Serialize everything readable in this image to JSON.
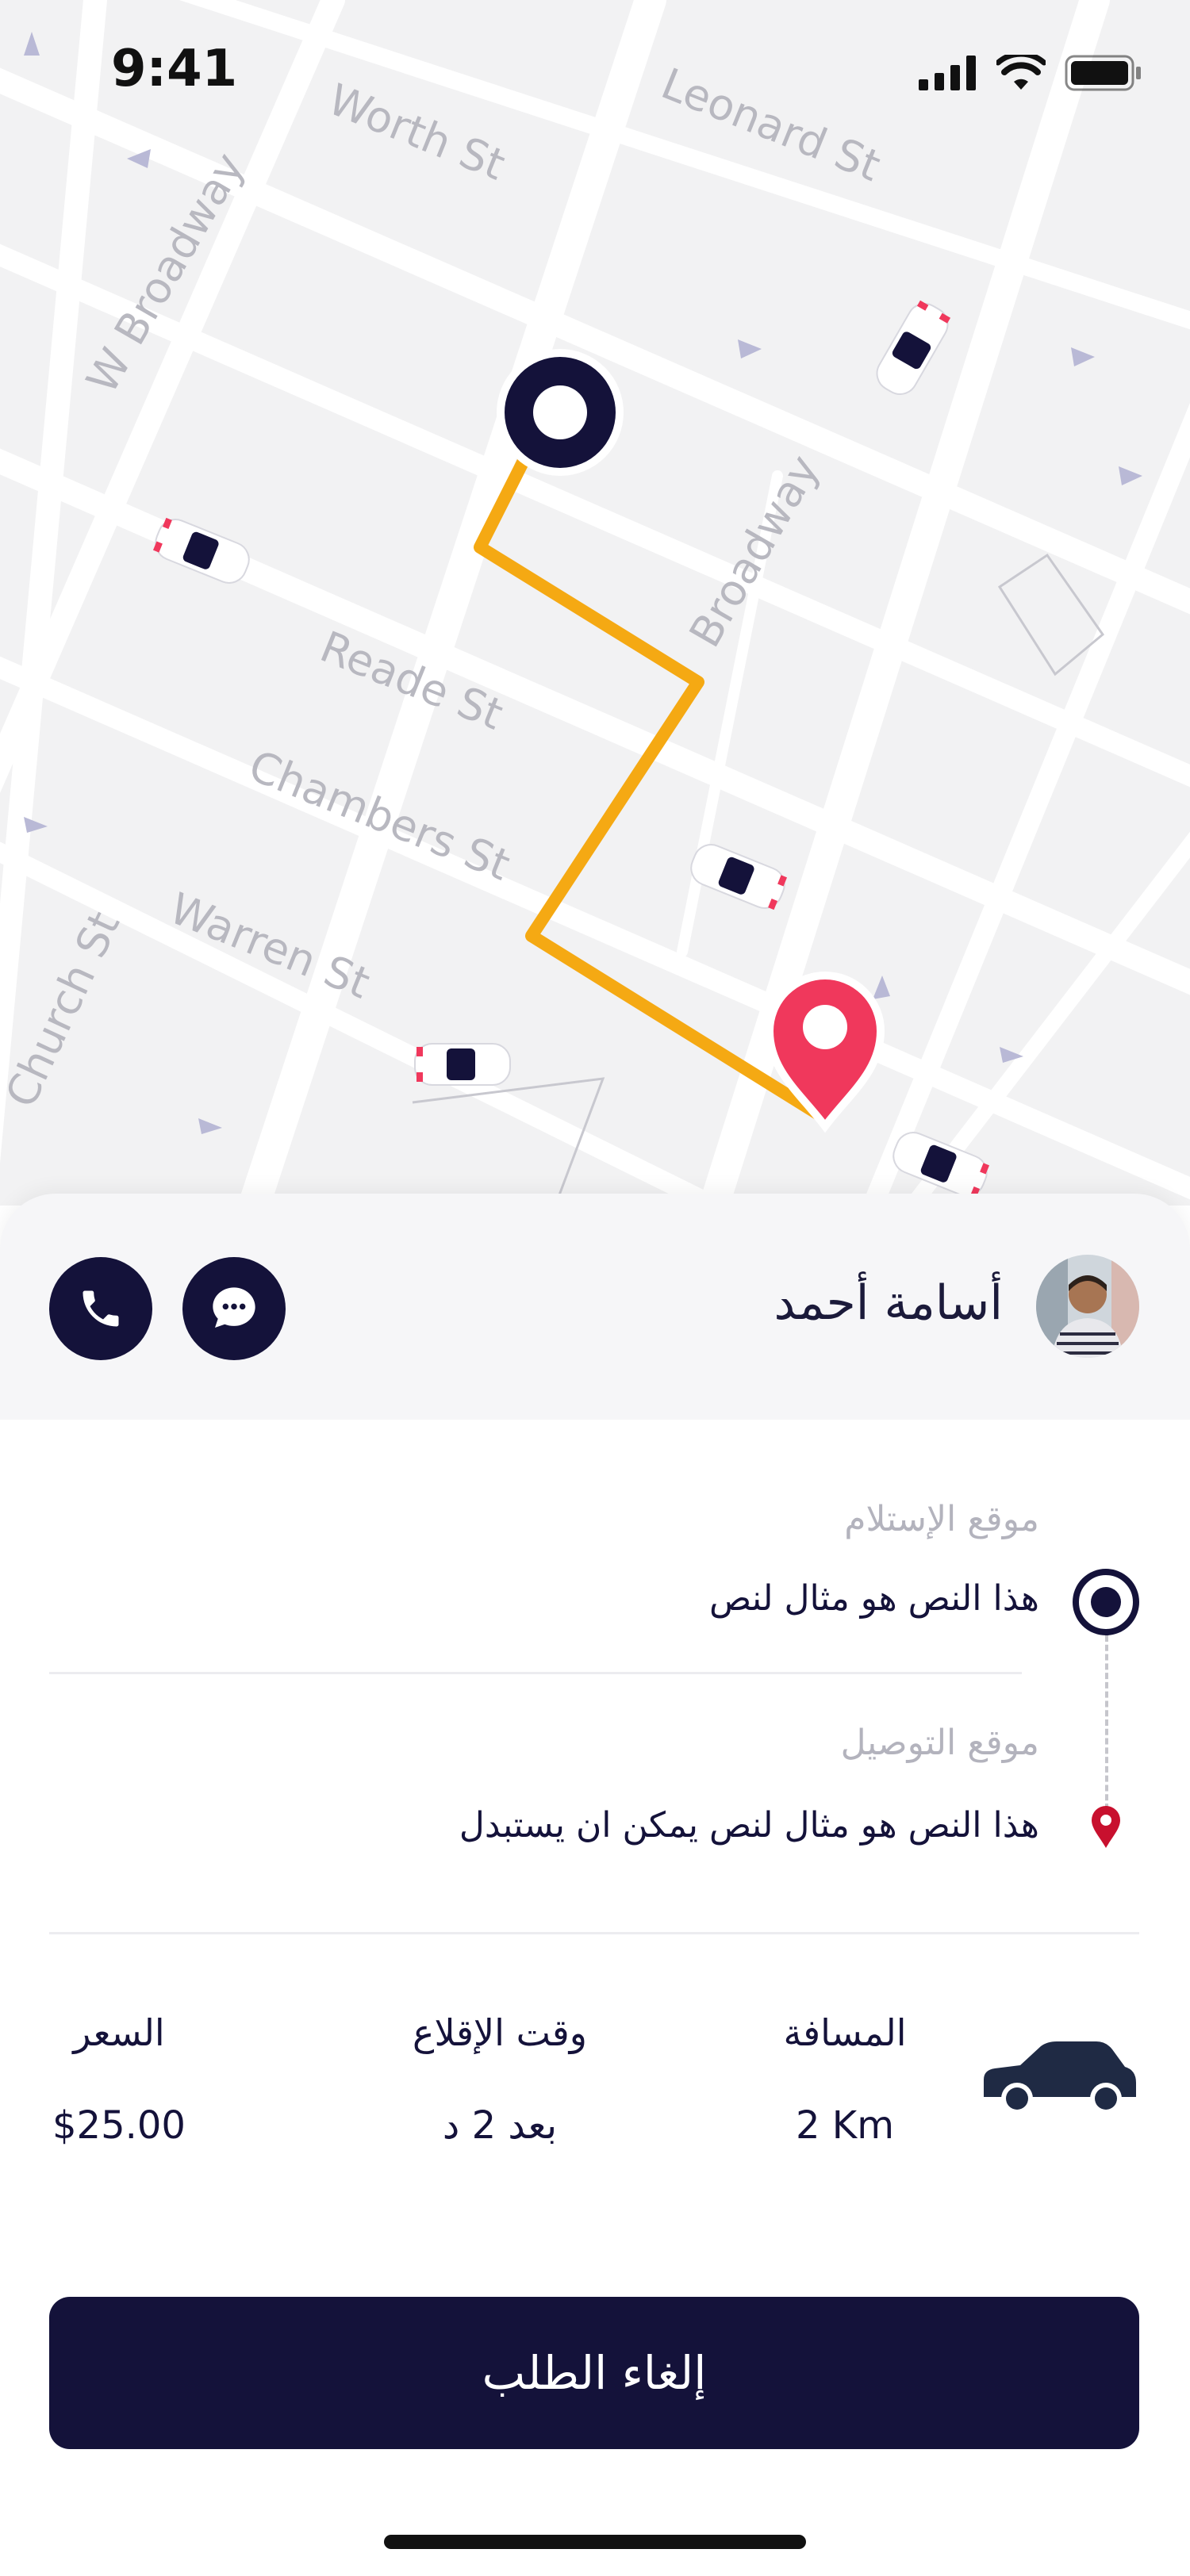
{
  "status_bar": {
    "time": "9:41"
  },
  "map": {
    "street_labels": {
      "worth": "Worth St",
      "leonard": "Leonard St",
      "w_broadway": "W Broadway",
      "broadway": "Broadway",
      "reade": "Reade St",
      "chambers": "Chambers St",
      "warren": "Warren St",
      "church": "Church St"
    },
    "route_color": "#F5A913",
    "origin_color": "#14123A",
    "destination_color": "#F0385C"
  },
  "driver": {
    "name": "أسامة أحمد",
    "call_icon": "phone-icon",
    "message_icon": "chat-icon"
  },
  "trip": {
    "pickup_label": "موقع الإستلام",
    "pickup_address": "هذا النص هو مثال لنص",
    "dropoff_label": "موقع التوصيل",
    "dropoff_address": "هذا النص هو مثال لنص يمكن ان يستبدل"
  },
  "stats": {
    "distance_label": "المسافة",
    "distance_value": "2 Km",
    "eta_label": "وقت الإقلاع",
    "eta_value": "بعد 2 د",
    "price_label": "السعر",
    "price_value": "$25.00"
  },
  "actions": {
    "cancel_label": "إلغاء الطلب"
  },
  "colors": {
    "primary": "#14123A",
    "accent": "#F0385C",
    "route": "#F5A913"
  }
}
